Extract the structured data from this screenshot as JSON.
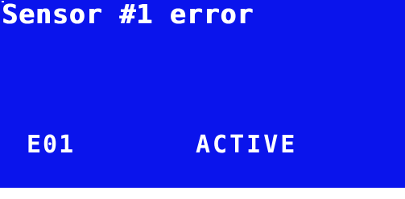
{
  "display": {
    "title": "Sensor #1 error",
    "error_code": "E01",
    "status": "ACTIVE"
  },
  "colors": {
    "background": "#0a14ec",
    "text": "#ffffff"
  }
}
